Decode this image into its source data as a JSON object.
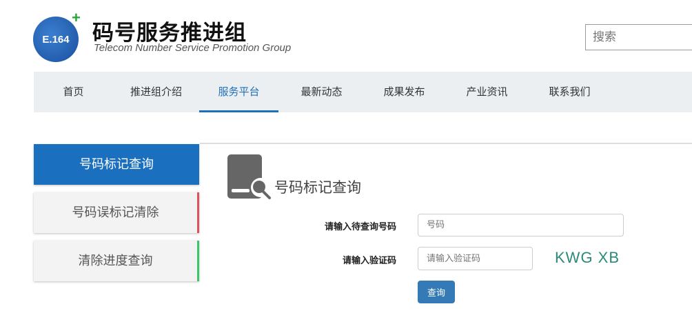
{
  "header": {
    "logo_text": "E.164",
    "title": "码号服务推进组",
    "subtitle": "Telecom Number Service  Promotion Group",
    "search_placeholder": "搜索"
  },
  "nav": {
    "items": [
      "首页",
      "推进组介绍",
      "服务平台",
      "最新动态",
      "成果发布",
      "产业资讯",
      "联系我们"
    ],
    "active": "服务平台"
  },
  "sidebar": {
    "items": [
      {
        "label": "号码标记查询",
        "active": true
      },
      {
        "label": "号码误标记清除"
      },
      {
        "label": "清除进度查询"
      }
    ]
  },
  "panel": {
    "title": "号码标记查询",
    "icon": "book-search-icon",
    "number_label": "请输入待查询号码",
    "number_placeholder": "号码",
    "captcha_label": "请输入验证码",
    "captcha_placeholder": "请输入验证码",
    "captcha_text": "KWG XB",
    "submit": "查询"
  },
  "colors": {
    "accent": "#1a6fbf",
    "button": "#337ab7",
    "red": "#e0505a",
    "green": "#3cc46a"
  }
}
